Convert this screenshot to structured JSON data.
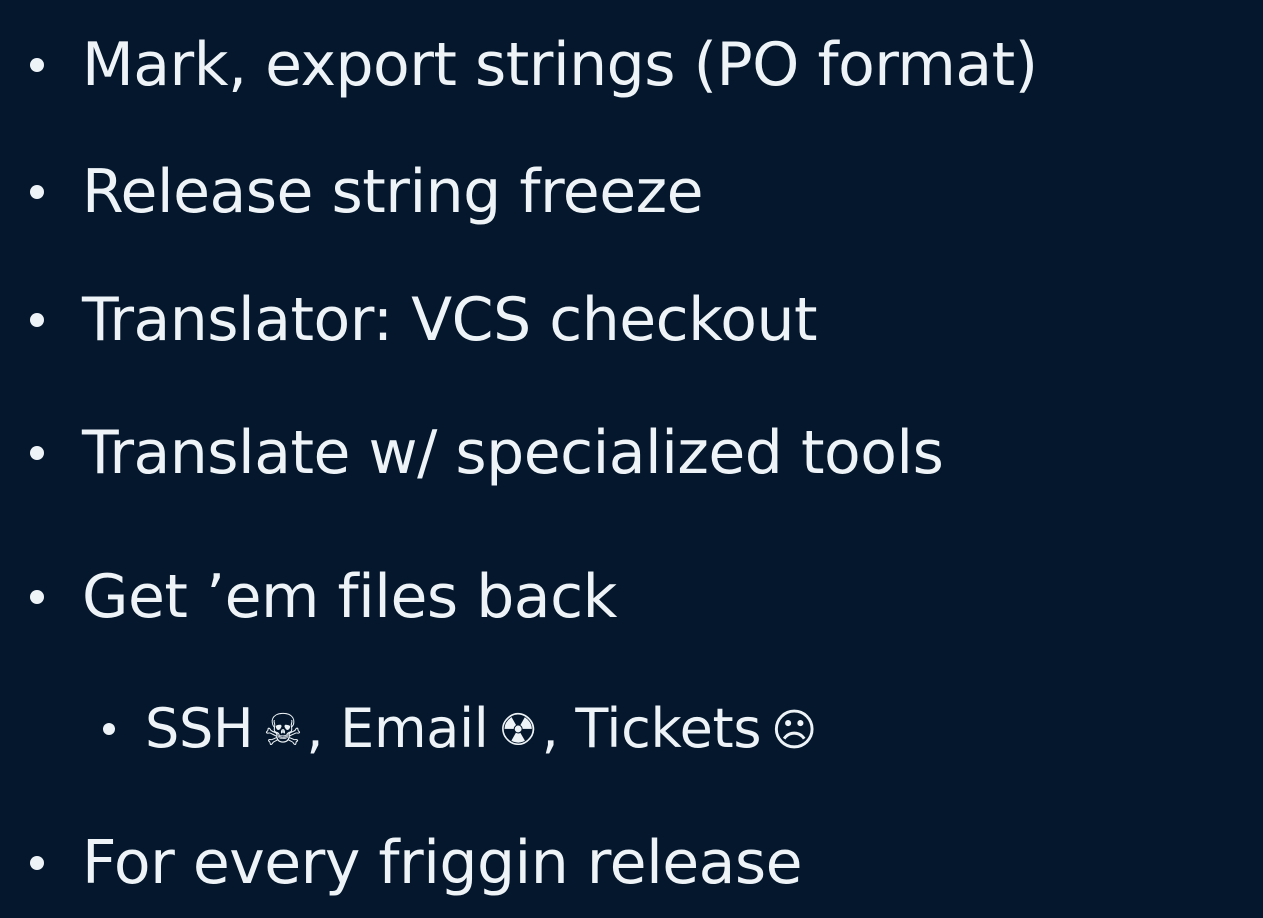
{
  "slide": {
    "bullets": [
      {
        "text": "Mark, export strings (PO format)"
      },
      {
        "text": "Release string freeze"
      },
      {
        "text": "Translator: VCS checkout"
      },
      {
        "text": "Translate w/ specialized tools"
      },
      {
        "text": "Get ’em files back"
      },
      {
        "sub": [
          {
            "label": "SSH",
            "icon": "skull-crossbones-icon",
            "glyph": "☠",
            "sep": ","
          },
          {
            "label": "Email",
            "icon": "radioactive-icon",
            "glyph": "☢",
            "sep": ","
          },
          {
            "label": "Tickets",
            "icon": "frowning-face-icon",
            "glyph": "☹",
            "sep": ""
          }
        ]
      },
      {
        "text": "For every friggin release"
      }
    ]
  }
}
